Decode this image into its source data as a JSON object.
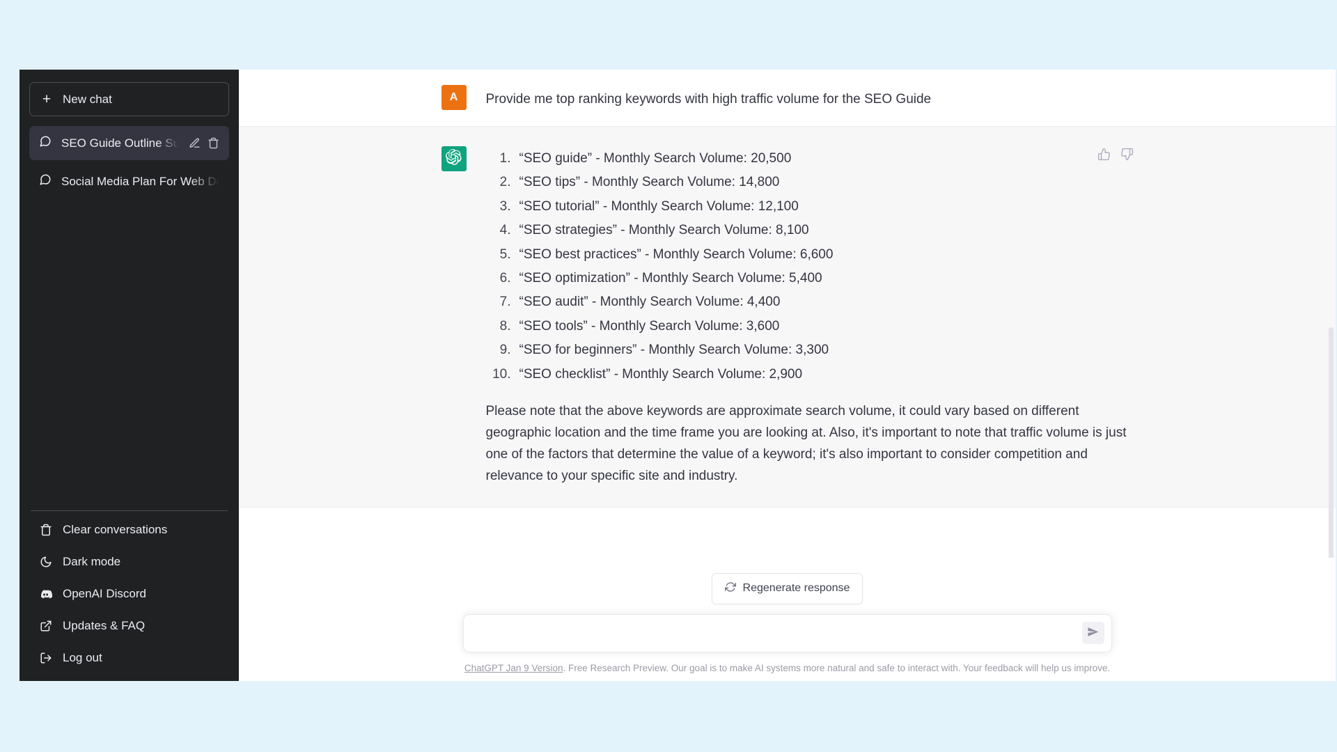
{
  "background_color": "#e3f3fc",
  "sidebar": {
    "background_color": "#202123",
    "new_chat": {
      "label": "New chat",
      "icon": "plus-icon"
    },
    "conversations": [
      {
        "label": "SEO Guide Outline Sug",
        "icon": "chat-bubble-icon",
        "active": true,
        "edit_icon": "pencil-icon",
        "delete_icon": "trash-icon"
      },
      {
        "label": "Social Media Plan For Web Dev",
        "icon": "chat-bubble-icon",
        "active": false
      }
    ],
    "menu": [
      {
        "label": "Clear conversations",
        "icon": "trash-icon"
      },
      {
        "label": "Dark mode",
        "icon": "moon-icon"
      },
      {
        "label": "OpenAI Discord",
        "icon": "discord-icon"
      },
      {
        "label": "Updates & FAQ",
        "icon": "external-link-icon"
      },
      {
        "label": "Log out",
        "icon": "logout-icon"
      }
    ]
  },
  "thread": {
    "user_message": {
      "avatar_initial": "A",
      "avatar_color": "#ec7211",
      "text": "Provide me top ranking keywords with high traffic volume for the SEO Guide"
    },
    "assistant_message": {
      "avatar_color": "#10a37f",
      "avatar_icon": "openai-logo-icon",
      "keywords": [
        "“SEO guide” - Monthly Search Volume: 20,500",
        "“SEO tips” - Monthly Search Volume: 14,800",
        "“SEO tutorial” - Monthly Search Volume: 12,100",
        "“SEO strategies” - Monthly Search Volume: 8,100",
        "“SEO best practices” - Monthly Search Volume: 6,600",
        "“SEO optimization” - Monthly Search Volume: 5,400",
        "“SEO audit” - Monthly Search Volume: 4,400",
        "“SEO tools” - Monthly Search Volume: 3,600",
        "“SEO for beginners” - Monthly Search Volume: 3,300",
        "“SEO checklist” - Monthly Search Volume: 2,900"
      ],
      "note": "Please note that the above keywords are approximate search volume, it could vary based on different geographic location and the time frame you are looking at. Also, it's important to note that traffic volume is just one of the factors that determine the value of a keyword; it's also important to consider competition and relevance to your specific site and industry.",
      "feedback": {
        "up_icon": "thumbs-up-icon",
        "down_icon": "thumbs-down-icon"
      }
    }
  },
  "composer": {
    "regenerate_label": "Regenerate response",
    "regenerate_icon": "refresh-icon",
    "input_value": "",
    "input_placeholder": "",
    "send_icon": "send-icon"
  },
  "footer": {
    "link_label": "ChatGPT Jan 9 Version",
    "text": ". Free Research Preview. Our goal is to make AI systems more natural and safe to interact with. Your feedback will help us improve."
  }
}
